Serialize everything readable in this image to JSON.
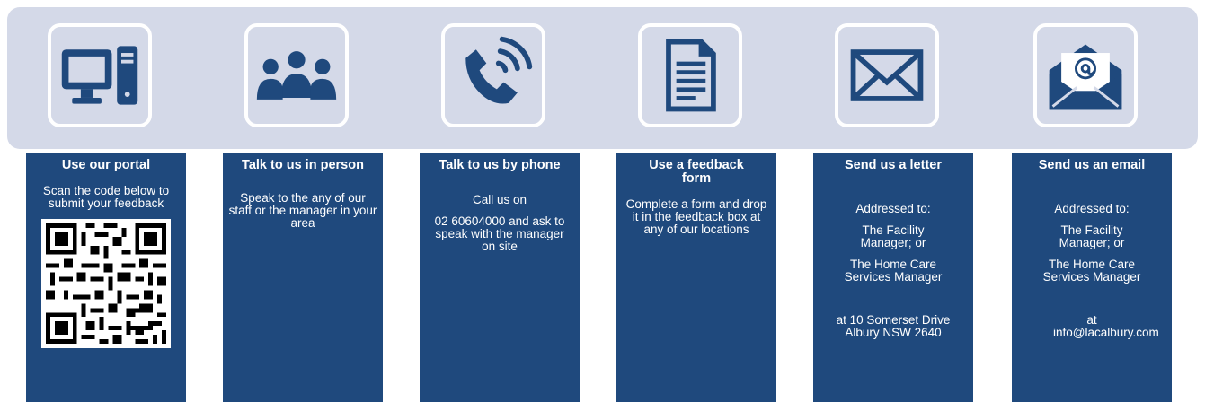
{
  "colors": {
    "band": "#d4d9e8",
    "card": "#1f497d",
    "icon": "#1f497d",
    "text": "#ffffff"
  },
  "columns": [
    {
      "icon": "computer-icon",
      "title": "Use our portal",
      "body": [
        "Scan the code below to submit your feedback"
      ],
      "has_qr": true
    },
    {
      "icon": "people-group-icon",
      "title": "Talk to us in person",
      "body": [
        "Speak to the any of our staff or the manager in your area"
      ]
    },
    {
      "icon": "phone-icon",
      "title": "Talk to us by phone",
      "body": [
        "Call us on",
        "02 60604000 and ask to speak with the manager on site"
      ]
    },
    {
      "icon": "document-icon",
      "title": "Use a feedback form",
      "body": [
        "Complete a form and drop it in the feedback box at any of our locations"
      ]
    },
    {
      "icon": "envelope-icon",
      "title": "Send us a letter",
      "body": [
        "Addressed to:",
        "The Facility Manager; or",
        "The Home Care Services Manager",
        "",
        "at 10 Somerset Drive Albury NSW 2640"
      ]
    },
    {
      "icon": "email-icon",
      "title": "Send us an email",
      "body": [
        "Addressed to:",
        "The Facility Manager; or",
        "The Home Care Services Manager",
        "",
        "at info@lacalbury.com"
      ]
    }
  ]
}
